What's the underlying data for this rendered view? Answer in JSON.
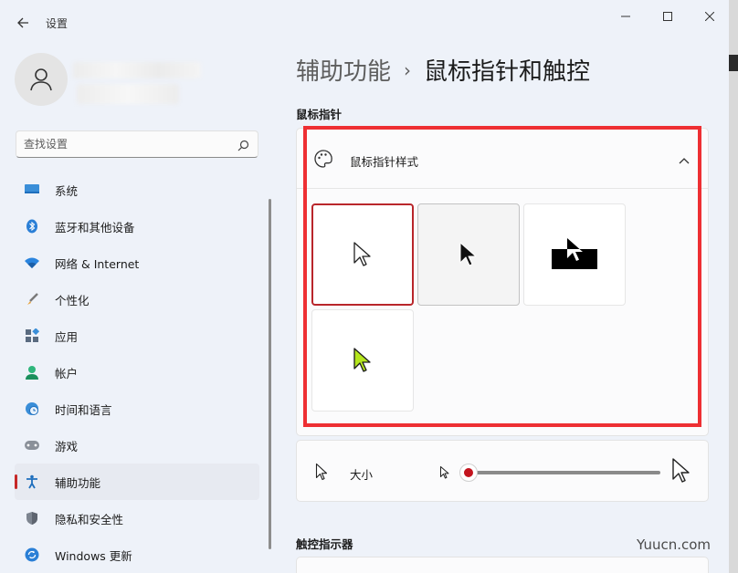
{
  "window": {
    "title": "设置",
    "controls": {
      "minimize": "minimize-icon",
      "maximize": "maximize-icon",
      "close": "close-icon"
    }
  },
  "search": {
    "placeholder": "查找设置",
    "value": ""
  },
  "sidebar": {
    "items": [
      {
        "label": "系统",
        "icon": "system-icon"
      },
      {
        "label": "蓝牙和其他设备",
        "icon": "bluetooth-icon"
      },
      {
        "label": "网络 & Internet",
        "icon": "wifi-icon"
      },
      {
        "label": "个性化",
        "icon": "brush-icon"
      },
      {
        "label": "应用",
        "icon": "apps-icon"
      },
      {
        "label": "帐户",
        "icon": "account-icon"
      },
      {
        "label": "时间和语言",
        "icon": "globe-clock-icon"
      },
      {
        "label": "游戏",
        "icon": "gamepad-icon"
      },
      {
        "label": "辅助功能",
        "icon": "accessibility-icon",
        "active": true
      },
      {
        "label": "隐私和安全性",
        "icon": "shield-icon"
      },
      {
        "label": "Windows 更新",
        "icon": "update-icon"
      }
    ]
  },
  "breadcrumb": {
    "parent": "辅助功能",
    "separator": "›",
    "current": "鼠标指针和触控"
  },
  "sections": {
    "mouse_pointer": "鼠标指针",
    "touch_indicator": "触控指示器"
  },
  "pointer_style": {
    "label": "鼠标指针样式",
    "expanded": true,
    "options": [
      {
        "name": "white",
        "selected": true
      },
      {
        "name": "black",
        "selected": false
      },
      {
        "name": "inverted",
        "selected": false
      },
      {
        "name": "custom",
        "selected": false,
        "color": "#b5e61d"
      }
    ]
  },
  "size": {
    "label": "大小",
    "value": 1,
    "min": 1,
    "max": 15
  },
  "colors": {
    "accent": "#c3141e",
    "highlight": "#ee2f33"
  },
  "watermark": "Yuucn.com"
}
